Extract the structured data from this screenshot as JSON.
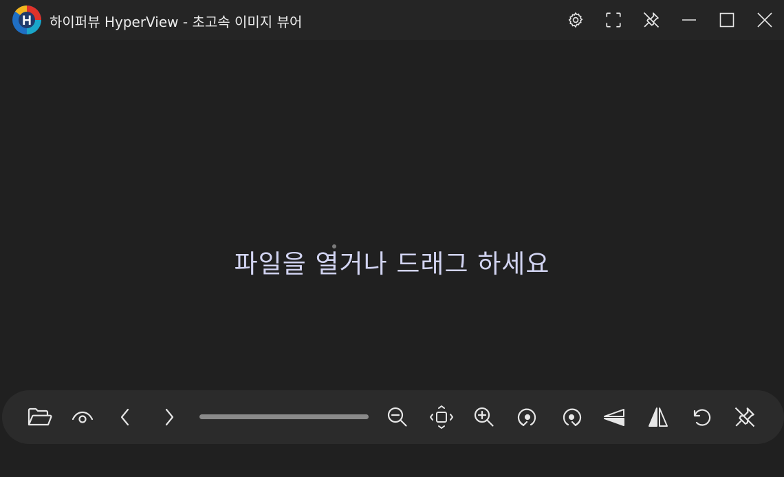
{
  "window": {
    "title": "하이퍼뷰 HyperView - 초고속 이미지 뷰어"
  },
  "titlebar_buttons": [
    {
      "name": "settings",
      "icon": "gear-icon"
    },
    {
      "name": "fullscreen",
      "icon": "fullscreen-icon"
    },
    {
      "name": "pin",
      "icon": "unpin-icon"
    },
    {
      "name": "minimize",
      "icon": "minimize-icon"
    },
    {
      "name": "maximize",
      "icon": "maximize-icon"
    },
    {
      "name": "close",
      "icon": "close-icon"
    }
  ],
  "main": {
    "placeholder": "파일을 열거나 드래그 하세요"
  },
  "toolbar": {
    "buttons": [
      {
        "name": "open-file",
        "icon": "folder-open-icon"
      },
      {
        "name": "view",
        "icon": "eye-icon"
      },
      {
        "name": "previous",
        "icon": "chevron-left-icon"
      },
      {
        "name": "next",
        "icon": "chevron-right-icon"
      },
      {
        "name": "zoom-out",
        "icon": "zoom-out-icon"
      },
      {
        "name": "fit-to-window",
        "icon": "fit-icon"
      },
      {
        "name": "zoom-in",
        "icon": "zoom-in-icon"
      },
      {
        "name": "rotate-left",
        "icon": "rotate-left-icon"
      },
      {
        "name": "rotate-right",
        "icon": "rotate-right-icon"
      },
      {
        "name": "flip-vertical",
        "icon": "flip-vertical-icon"
      },
      {
        "name": "flip-horizontal",
        "icon": "flip-horizontal-icon"
      },
      {
        "name": "reset",
        "icon": "undo-icon"
      },
      {
        "name": "pin",
        "icon": "unpin-icon"
      }
    ],
    "slider_position": 0
  },
  "colors": {
    "background": "#202020",
    "titlebar": "#252525",
    "toolbar": "#2b2b2b",
    "placeholder_text": "#d2d4f2",
    "icon": "#e6e6e6",
    "logo_red": "#e0322a",
    "logo_yellow": "#f2b51e",
    "logo_blue": "#1f6fc4",
    "logo_teal": "#1aa6c9"
  }
}
